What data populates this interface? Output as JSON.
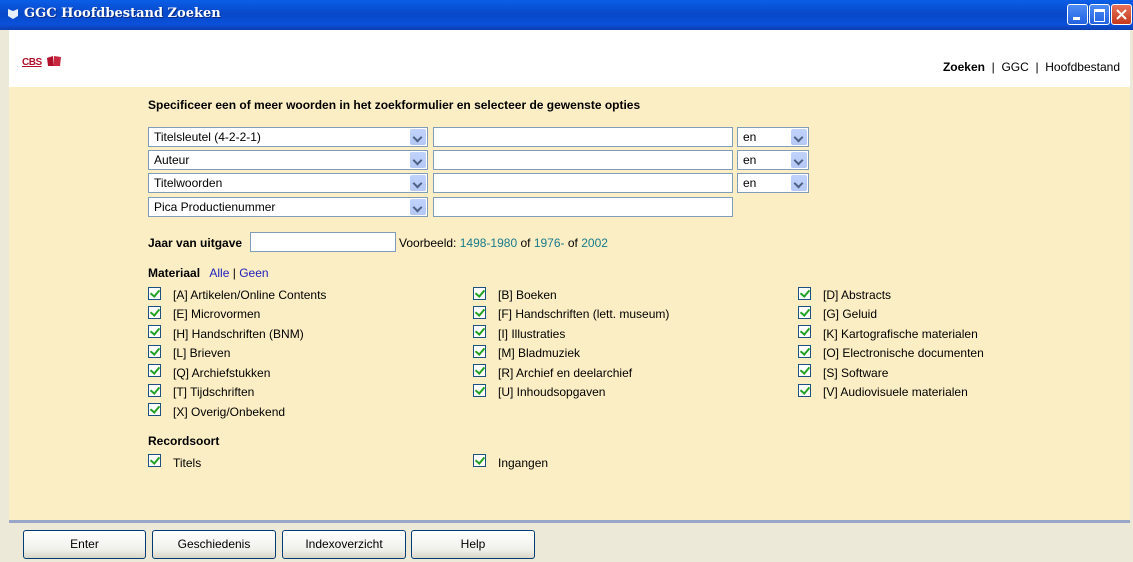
{
  "window": {
    "title": "GGC Hoofdbestand Zoeken"
  },
  "header": {
    "logo_text": "CBS",
    "crumbs": [
      "Zoeken",
      "GGC",
      "Hoofdbestand"
    ]
  },
  "form": {
    "instruction": "Specificeer een of meer woorden in het zoekformulier en selecteer de gewenste opties",
    "rows": [
      {
        "field": "Titelsleutel (4-2-2-1)",
        "value": "",
        "operator": "en"
      },
      {
        "field": "Auteur",
        "value": "",
        "operator": "en"
      },
      {
        "field": "Titelwoorden",
        "value": "",
        "operator": "en"
      },
      {
        "field": "Pica Productienummer",
        "value": ""
      }
    ],
    "year_label": "Jaar van uitgave",
    "year_value": "",
    "example_prefix": "Voorbeeld:",
    "example_1": "1498-1980",
    "example_of1": "of",
    "example_2": "1976-",
    "example_of2": "of",
    "example_3": "2002"
  },
  "materiaal": {
    "label": "Materiaal",
    "all": "Alle",
    "sep": "|",
    "none": "Geen",
    "items": [
      "[A] Artikelen/Online Contents",
      "[B] Boeken",
      "[D] Abstracts",
      "[E] Microvormen",
      "[F] Handschriften (lett. museum)",
      "[G] Geluid",
      "[H] Handschriften (BNM)",
      "[I] Illustraties",
      "[K] Kartografische materialen",
      "[L] Brieven",
      "[M] Bladmuziek",
      "[O] Electronische documenten",
      "[Q] Archiefstukken",
      "[R] Archief en deelarchief",
      "[S] Software",
      "[T] Tijdschriften",
      "[U] Inhoudsopgaven",
      "[V] Audiovisuele materialen",
      "[X] Overig/Onbekend"
    ]
  },
  "recordsoort": {
    "label": "Recordsoort",
    "items": [
      "Titels",
      "Ingangen"
    ]
  },
  "buttons": {
    "enter": "Enter",
    "history": "Geschiedenis",
    "index": "Indexoverzicht",
    "help": "Help"
  },
  "colors": {
    "titlebar": "#0a50da",
    "pane": "#fbeec4",
    "example_link": "#1a7a8c",
    "link": "#2020c0",
    "check": "#21a121"
  }
}
